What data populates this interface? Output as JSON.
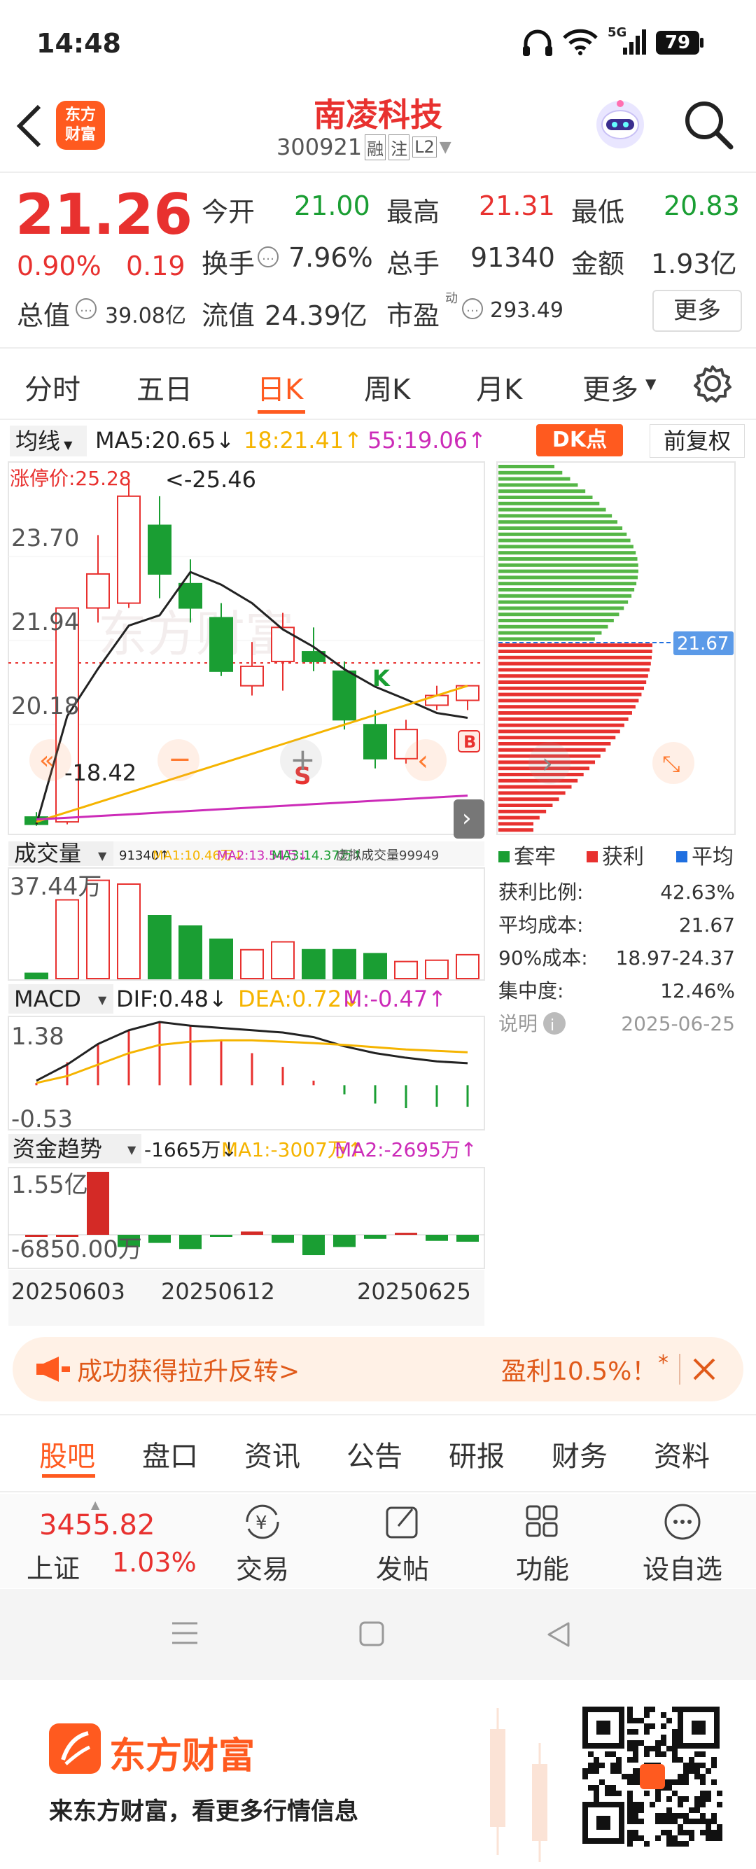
{
  "status_bar": {
    "time": "14:48",
    "battery": "79",
    "network": "5G"
  },
  "header": {
    "title": "南凌科技",
    "code": "300921",
    "tags": [
      "融",
      "注",
      "L2"
    ],
    "logo_text_1": "东方",
    "logo_text_2": "财富"
  },
  "quote": {
    "price": "21.26",
    "change_pct": "0.90%",
    "change": "0.19",
    "open_label": "今开",
    "open": "21.00",
    "high_label": "最高",
    "high": "21.31",
    "low_label": "最低",
    "low": "20.83",
    "turnover_label": "换手",
    "turnover": "7.96%",
    "volume_label": "总手",
    "volume": "91340",
    "amount_label": "金额",
    "amount": "1.93亿",
    "mcap_label": "总值",
    "mcap": "39.08亿",
    "float_label": "流值",
    "float_value": "24.39亿",
    "pe_label": "市盈",
    "pe_sup": "动",
    "pe": "293.49",
    "more_button": "更多"
  },
  "period_tabs": [
    "分时",
    "五日",
    "日K",
    "周K",
    "月K",
    "更多"
  ],
  "active_tab": 2,
  "kline": {
    "ma_selector": "均线",
    "ma5": "MA5:20.65↓",
    "ma18": "18:21.41↑",
    "ma55": "55:19.06↑",
    "dk_button": "DK点",
    "adjust_button": "前复权",
    "limit_label": "涨停价:25.28",
    "peak_label": "<-25.46",
    "low_label": "-18.42",
    "y_labels": [
      "23.70",
      "21.94",
      "20.18"
    ],
    "k_marker": "K",
    "b_marker": "B",
    "s_marker": "S"
  },
  "chip": {
    "avg_cost_tag": "21.67",
    "legend": [
      "套牢",
      "获利",
      "平均"
    ],
    "rows": [
      {
        "label": "获利比例:",
        "value": "42.63%"
      },
      {
        "label": "平均成本:",
        "value": "21.67"
      },
      {
        "label": "90%成本:",
        "value": "18.97-24.37"
      },
      {
        "label": "集中度:",
        "value": "12.46%"
      }
    ],
    "note_label": "说明",
    "date": "2025-06-25"
  },
  "volume": {
    "selector": "成交量",
    "stats": "91340↑",
    "ma1": "MA1:10.46万↓",
    "ma2": "MA2:13.54万↓",
    "ma3": "MA3:14.37万↑",
    "virtual": "虚拟成交量99949",
    "y_label": "37.44万"
  },
  "macd": {
    "selector": "MACD",
    "dif": "DIF:0.48↓",
    "dea": "DEA:0.72↓",
    "m": "M:-0.47↑",
    "y_top": "1.38",
    "y_bottom": "-0.53"
  },
  "fund": {
    "selector": "资金趋势",
    "value": "-1665万↓",
    "ma1": "MA1:-3007万↑",
    "ma2": "MA2:-2695万↑",
    "y_top": "1.55亿",
    "y_bottom": "-6850.00万",
    "dates": [
      "20250603",
      "20250612",
      "20250625"
    ]
  },
  "banner": {
    "left_text": "成功获得拉升反转>",
    "right_text": "盈利10.5%！",
    "star": "*"
  },
  "bottom_tabs": [
    "股吧",
    "盘口",
    "资讯",
    "公告",
    "研报",
    "财务",
    "资料"
  ],
  "bottom_bar": {
    "index_value": "3455.82",
    "index_name": "上证",
    "index_pct": "1.03%",
    "trade": "交易",
    "post": "发帖",
    "func": "功能",
    "watch": "设自选"
  },
  "promo": {
    "brand": "东方财富",
    "slogan": "来东方财富，看更多行情信息"
  },
  "colors": {
    "red": "#e8312f",
    "green": "#1a9e33",
    "orange": "#ff6a00",
    "yellow": "#f5b400",
    "magenta": "#cc2bb8"
  },
  "chart_data": [
    {
      "type": "candlestick",
      "title": "日K",
      "candles": [
        {
          "o": 18.6,
          "c": 18.45,
          "h": 18.7,
          "l": 18.42
        },
        {
          "o": 18.5,
          "c": 22.9,
          "h": 22.9,
          "l": 18.45
        },
        {
          "o": 22.9,
          "c": 23.6,
          "h": 24.4,
          "l": 22.6
        },
        {
          "o": 23.0,
          "c": 25.2,
          "h": 25.46,
          "l": 22.9
        },
        {
          "o": 24.6,
          "c": 23.6,
          "h": 25.2,
          "l": 23.1
        },
        {
          "o": 23.4,
          "c": 22.9,
          "h": 23.9,
          "l": 22.6
        },
        {
          "o": 22.7,
          "c": 21.6,
          "h": 23.0,
          "l": 21.5
        },
        {
          "o": 21.3,
          "c": 21.7,
          "h": 22.2,
          "l": 21.1
        },
        {
          "o": 21.8,
          "c": 22.5,
          "h": 22.8,
          "l": 21.2
        },
        {
          "o": 22.0,
          "c": 21.8,
          "h": 22.5,
          "l": 21.6
        },
        {
          "o": 21.6,
          "c": 20.6,
          "h": 21.8,
          "l": 20.4
        },
        {
          "o": 20.5,
          "c": 19.8,
          "h": 20.8,
          "l": 19.6
        },
        {
          "o": 19.8,
          "c": 20.4,
          "h": 20.6,
          "l": 19.7
        },
        {
          "o": 20.9,
          "c": 21.1,
          "h": 21.3,
          "l": 20.8
        },
        {
          "o": 21.0,
          "c": 21.3,
          "h": 21.3,
          "l": 20.8
        }
      ]
    },
    {
      "type": "bar",
      "title": "成交量",
      "values": [
        2,
        30,
        37.44,
        36,
        24,
        20,
        15,
        11,
        14,
        11,
        11,
        9.5,
        6.5,
        7,
        9.1
      ]
    },
    {
      "type": "bar",
      "title": "MACD",
      "values": [
        0.05,
        0.5,
        0.9,
        1.2,
        1.38,
        1.3,
        1.0,
        0.7,
        0.4,
        0.1,
        -0.2,
        -0.4,
        -0.5,
        -0.47,
        -0.47
      ],
      "dif": [
        0.1,
        0.45,
        0.9,
        1.2,
        1.38,
        1.3,
        1.25,
        1.2,
        1.15,
        1.05,
        0.85,
        0.7,
        0.6,
        0.52,
        0.48
      ],
      "dea": [
        0.05,
        0.2,
        0.45,
        0.7,
        0.88,
        0.95,
        0.98,
        0.98,
        0.95,
        0.92,
        0.88,
        0.83,
        0.78,
        0.75,
        0.72
      ]
    },
    {
      "type": "bar",
      "title": "资金趋势",
      "values": [
        0,
        0,
        1.55,
        -0.3,
        -0.2,
        -0.35,
        -0.05,
        0.08,
        -0.2,
        -0.5,
        -0.3,
        -0.1,
        0.05,
        -0.15,
        -0.17
      ]
    }
  ]
}
